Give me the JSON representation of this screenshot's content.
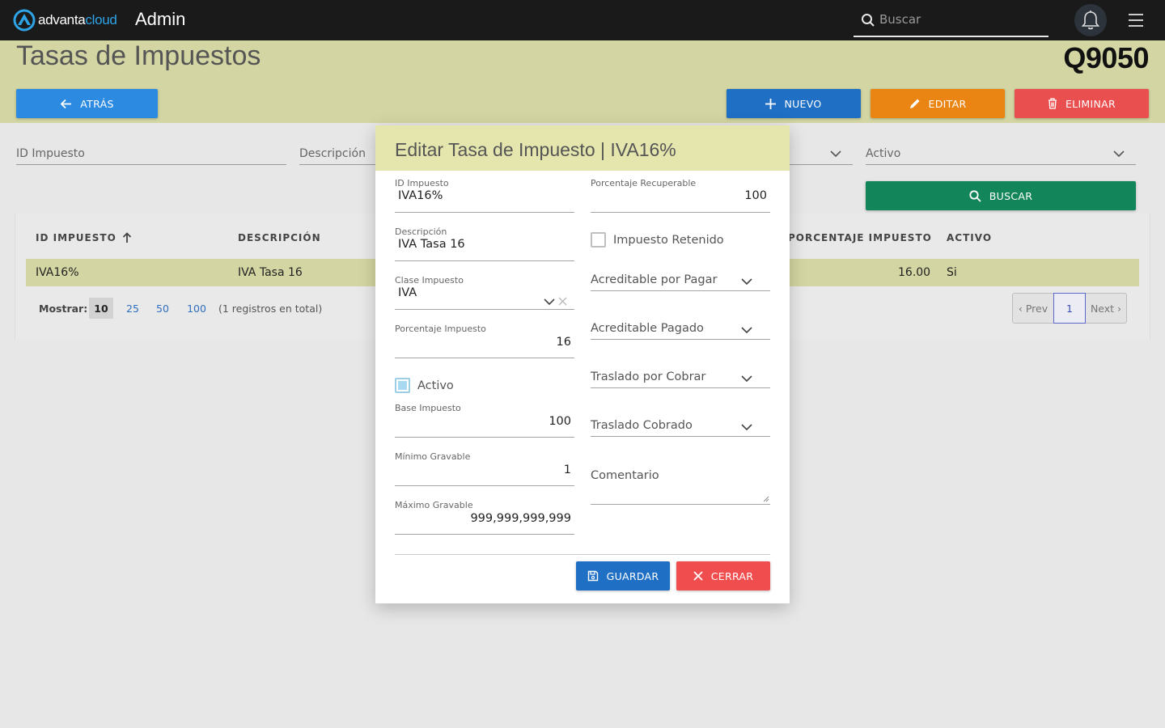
{
  "app": {
    "brand_main": "advanta",
    "brand_accent": "cloud",
    "section": "Admin",
    "search_placeholder": "Buscar"
  },
  "header": {
    "title": "Tasas de Impuestos",
    "code": "Q9050",
    "back_label": "ATRÁS",
    "new_label": "NUEVO",
    "edit_label": "EDITAR",
    "delete_label": "ELIMINAR"
  },
  "filters": {
    "id_label": "ID Impuesto",
    "descripcion_label": "Descripción",
    "activo_label": "Activo",
    "search_label": "BUSCAR"
  },
  "table": {
    "columns": [
      "ID IMPUESTO",
      "DESCRIPCIÓN",
      "PORCENTAJE IMPUESTO",
      "ACTIVO"
    ],
    "rows": [
      {
        "id": "IVA16%",
        "descripcion": "IVA Tasa 16",
        "porcentaje": "16.00",
        "activo": "Si"
      }
    ],
    "show_label": "Mostrar:",
    "page_sizes": [
      "10",
      "25",
      "50",
      "100"
    ],
    "total_text": "(1 registros en total)",
    "prev_label": "‹ Prev",
    "current_page": "1",
    "next_label": "Next ›"
  },
  "modal": {
    "title": "Editar Tasa de Impuesto | IVA16%",
    "id_label": "ID Impuesto",
    "id_value": "IVA16%",
    "descripcion_label": "Descripción",
    "descripcion_value": "IVA Tasa 16",
    "clase_label": "Clase Impuesto",
    "clase_value": "IVA",
    "porcentaje_label": "Porcentaje Impuesto",
    "porcentaje_value": "16",
    "activo_label": "Activo",
    "activo_checked": true,
    "base_label": "Base Impuesto",
    "base_value": "100",
    "minimo_label": "Mínimo Gravable",
    "minimo_value": "1",
    "maximo_label": "Máximo Gravable",
    "maximo_value": "999,999,999,999",
    "recuperable_label": "Porcentaje Recuperable",
    "recuperable_value": "100",
    "retenido_label": "Impuesto Retenido",
    "retenido_checked": false,
    "acreditable_pagar": "Acreditable por Pagar",
    "acreditable_pagado": "Acreditable Pagado",
    "trasladado_cobrar": "Traslado por Cobrar",
    "trasladado_cobrado": "Traslado Cobrado",
    "comentario_placeholder": "Comentario",
    "save_label": "GUARDAR",
    "close_label": "CERRAR"
  },
  "colors": {
    "topbar": "#1a1a1a",
    "band": "#d3d6a2",
    "primary": "#1f6fc4",
    "edit": "#ea8514",
    "delete": "#ea4f4f",
    "search": "#12855a"
  }
}
